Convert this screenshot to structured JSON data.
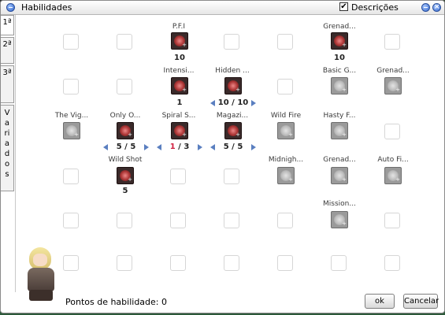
{
  "window": {
    "title": "Habilidades",
    "descriptions_label": "Descrições",
    "descriptions_checked": "✔"
  },
  "tabs": [
    {
      "label": "1ª"
    },
    {
      "label": "2ª"
    },
    {
      "label": "3ª"
    },
    {
      "label": "Variados"
    }
  ],
  "skills": {
    "pfi": {
      "name": "P.F.I",
      "level": "10"
    },
    "grenade_top": {
      "name": "Grenad...",
      "level": "10"
    },
    "intensify": {
      "name": "Intensi...",
      "level": "1"
    },
    "hidden": {
      "name": "Hidden ...",
      "current": "10",
      "max": "10"
    },
    "basic_g": {
      "name": "Basic G..."
    },
    "grenad_r2": {
      "name": "Grenad..."
    },
    "vigilante": {
      "name": "The Vig..."
    },
    "only_one": {
      "name": "Only O...",
      "current": "5",
      "max": "5"
    },
    "spiral": {
      "name": "Spiral S...",
      "current": "1",
      "max": "3"
    },
    "magazine": {
      "name": "Magazi...",
      "current": "5",
      "max": "5"
    },
    "wild_fire": {
      "name": "Wild Fire"
    },
    "hasty": {
      "name": "Hasty F..."
    },
    "wild_shot": {
      "name": "Wild Shot",
      "level": "5"
    },
    "midnight": {
      "name": "Midnigh..."
    },
    "grenad_r4": {
      "name": "Grenad..."
    },
    "auto_fire": {
      "name": "Auto Fi..."
    },
    "mission": {
      "name": "Mission..."
    }
  },
  "footer": {
    "points_label": "Pontos de habilidade: 0",
    "ok_label": "ok",
    "cancel_label": "Cancelar"
  },
  "icons": {
    "title": "window-icon",
    "minimize": "minimize-icon",
    "close": "close-icon"
  }
}
